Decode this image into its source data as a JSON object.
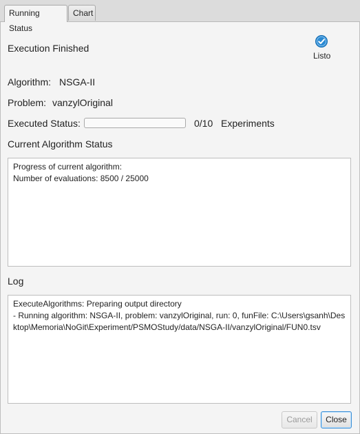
{
  "tabs": [
    {
      "label": "Running Status",
      "active": true
    },
    {
      "label": "Chart",
      "active": false
    }
  ],
  "execution": {
    "status": "Execution Finished",
    "ready_label": "Listo",
    "ready_icon": "check-circle-icon",
    "accent_color": "#3a8fd6"
  },
  "algorithm": {
    "label": "Algorithm:",
    "value": "NSGA-II"
  },
  "problem": {
    "label": "Problem:",
    "value": "vanzylOriginal"
  },
  "executed": {
    "label": "Executed Status:",
    "progress_fraction": 0,
    "count": "0/10",
    "unit": "Experiments"
  },
  "current_status": {
    "heading": "Current Algorithm Status",
    "lines": [
      "Progress of current algorithm:",
      "Number of evaluations: 8500 / 25000"
    ]
  },
  "log": {
    "heading": "Log",
    "lines": [
      "ExecuteAlgorithms: Preparing output directory",
      "- Running algorithm: NSGA-II, problem: vanzylOriginal, run: 0, funFile: C:\\Users\\gsanh\\Desktop\\Memoria\\NoGit\\Experiment/PSMOStudy/data/NSGA-II/vanzylOriginal/FUN0.tsv"
    ]
  },
  "buttons": {
    "cancel": {
      "label": "Cancel",
      "enabled": false
    },
    "close": {
      "label": "Close",
      "enabled": true
    }
  }
}
